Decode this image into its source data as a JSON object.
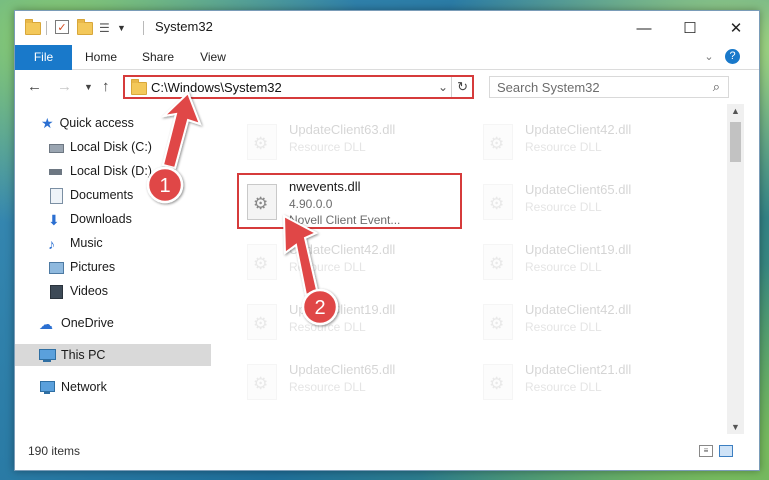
{
  "window": {
    "title": "System32"
  },
  "ribbon": {
    "tabs": [
      "File",
      "Home",
      "Share",
      "View"
    ]
  },
  "address": {
    "path": "C:\\Windows\\System32"
  },
  "search": {
    "placeholder": "Search System32"
  },
  "sidebar": {
    "quick_access": "Quick access",
    "items": [
      "Local Disk (C:)",
      "Local Disk (D:)",
      "Documents",
      "Downloads",
      "Music",
      "Pictures",
      "Videos"
    ],
    "onedrive": "OneDrive",
    "thispc": "This PC",
    "network": "Network"
  },
  "files": [
    {
      "name": "UpdateClient63.dll",
      "desc": "Resource DLL"
    },
    {
      "name": "UpdateClient42.dll",
      "desc": "Resource DLL"
    },
    {
      "name": "nwevents.dll",
      "version": "4.90.0.0",
      "desc": "Novell Client Event..."
    },
    {
      "name": "UpdateClient65.dll",
      "desc": "Resource DLL"
    },
    {
      "name": "UpdateClient42.dll",
      "desc": "Resource DLL"
    },
    {
      "name": "UpdateClient19.dll",
      "desc": "Resource DLL"
    },
    {
      "name": "UpdateClient19.dll",
      "desc": "Resource DLL"
    },
    {
      "name": "UpdateClient42.dll",
      "desc": "Resource DLL"
    },
    {
      "name": "UpdateClient65.dll",
      "desc": "Resource DLL"
    },
    {
      "name": "UpdateClient21.dll",
      "desc": "Resource DLL"
    }
  ],
  "status": {
    "count": "190 items"
  },
  "annotations": {
    "step1": "1",
    "step2": "2"
  },
  "colors": {
    "accent": "#1979ca",
    "highlight": "#d63b3b"
  }
}
